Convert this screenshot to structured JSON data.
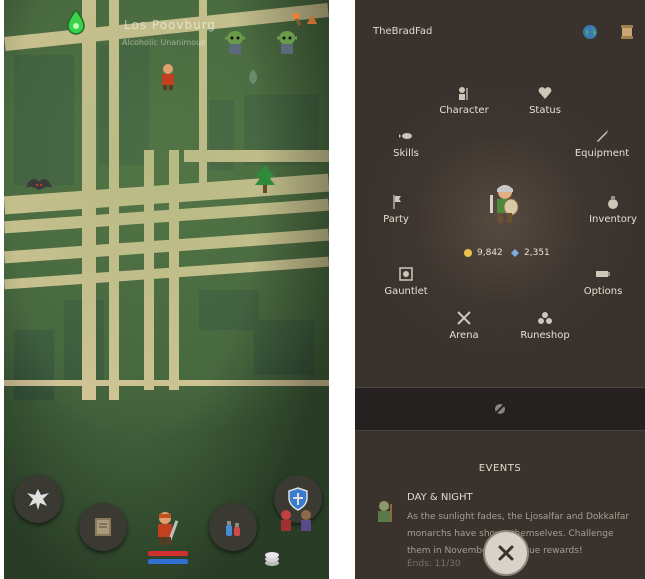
{
  "map_screen": {
    "city_name": "Los Poovburg",
    "city_subtitle": "Alcoholic Unanimous",
    "buttons": {
      "guild": "eagle-emblem-icon",
      "journal": "book-icon",
      "potions": "potions-icon",
      "shield": "shield-icon",
      "wallet": "coins-icon"
    },
    "player": {
      "health_fraction": 1.0,
      "mana_fraction": 1.0
    }
  },
  "menu_screen": {
    "username": "TheBradFad",
    "items": {
      "character": "Character",
      "status": "Status",
      "skills": "Skills",
      "equipment": "Equipment",
      "party": "Party",
      "inventory": "Inventory",
      "gauntlet": "Gauntlet",
      "options": "Options",
      "arena": "Arena",
      "runeshop": "Runeshop"
    },
    "gold": "9,842",
    "gems": "2,351",
    "events": {
      "title": "EVENTS",
      "name": "DAY & NIGHT",
      "description": "As the sunlight fades, the Ljosalfar and Dokkalfar monarchs have shown themselves. Challenge them in November for unique rewards!",
      "ends": "Ends: 11/30"
    },
    "colors": {
      "gold": "#e8c24a",
      "gem": "#7ab0e0",
      "health": "#d03030",
      "mana": "#3070d0"
    }
  }
}
